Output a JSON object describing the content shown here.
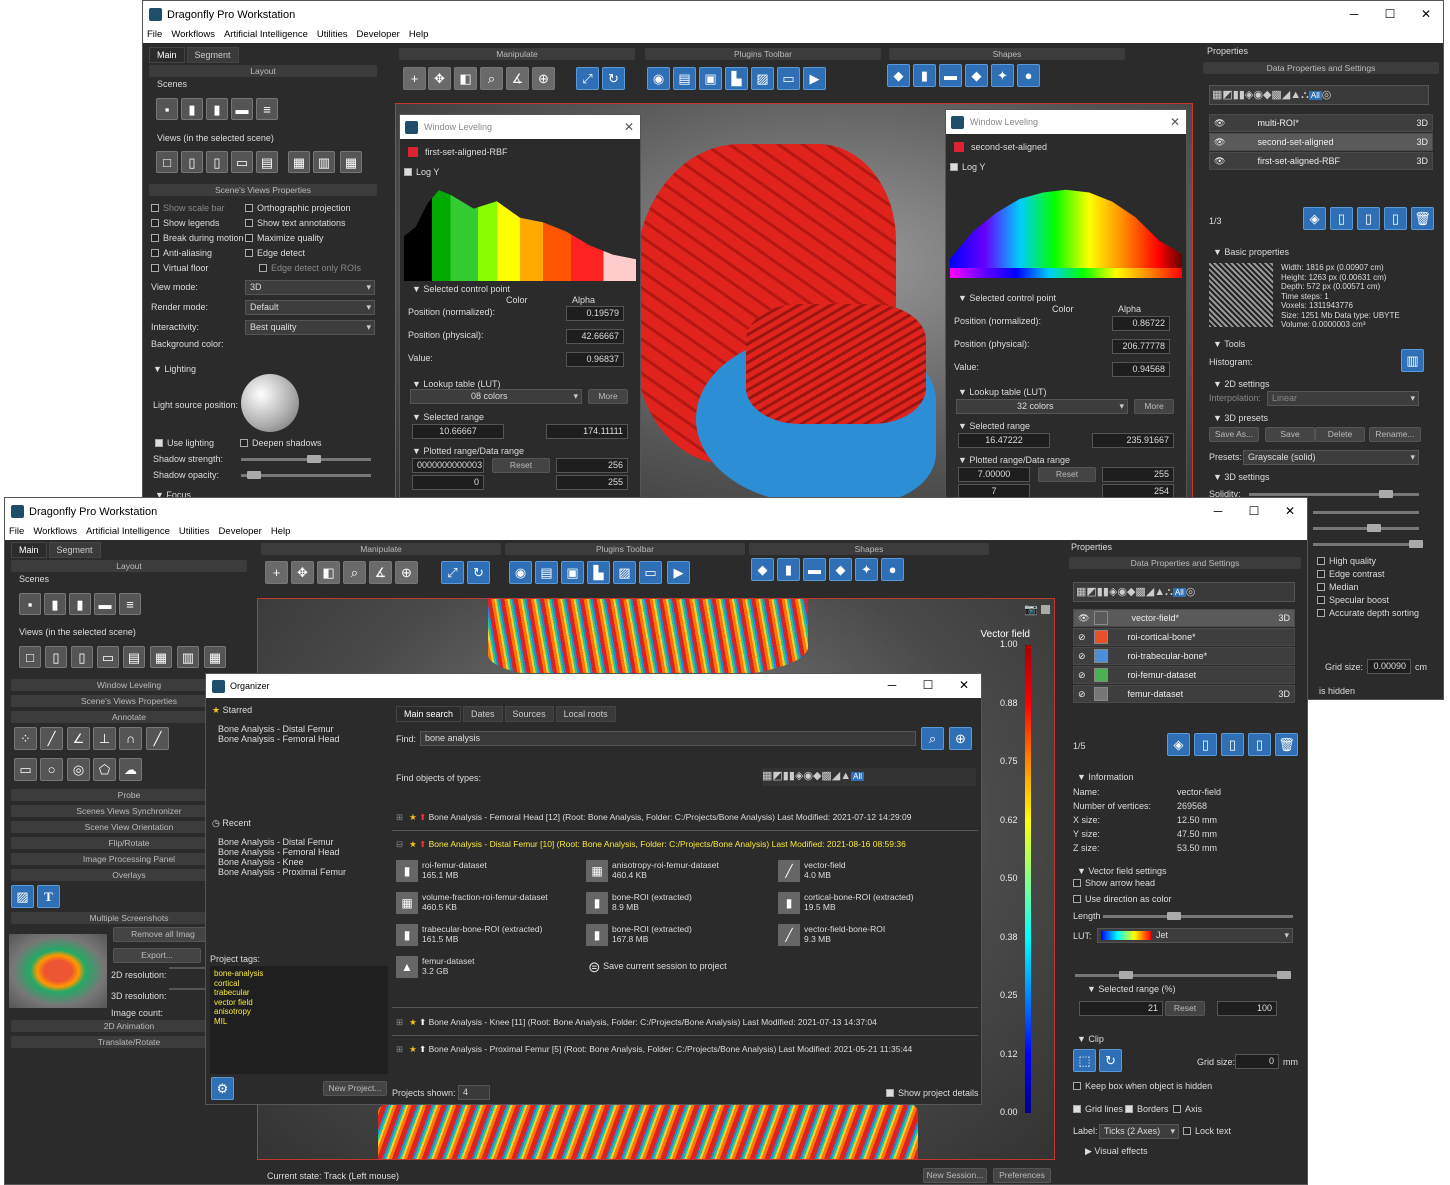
{
  "app": {
    "title": "Dragonfly Pro Workstation"
  },
  "menu": [
    "File",
    "Workflows",
    "Artificial Intelligence",
    "Utilities",
    "Developer",
    "Help"
  ],
  "tabs": {
    "main": "Main",
    "segment": "Segment"
  },
  "toolbars": {
    "manipulate": "Manipulate",
    "plugins": "Plugins Toolbar",
    "shapes": "Shapes"
  },
  "back": {
    "layout": "Layout",
    "scenes": "Scenes",
    "views": "Views (in the selected scene)",
    "svp": "Scene's Views Properties",
    "opts": [
      [
        "Show scale bar",
        "Orthographic projection"
      ],
      [
        "Show legends",
        "Show text annotations"
      ],
      [
        "Break during motion",
        "Maximize quality"
      ],
      [
        "Anti-aliasing",
        "Edge detect"
      ],
      [
        "Virtual floor",
        "Edge detect only ROIs"
      ]
    ],
    "view_mode_label": "View mode:",
    "view_mode": "3D",
    "render_mode_label": "Render mode:",
    "render_mode": "Default",
    "interactivity_label": "Interactivity:",
    "interactivity": "Best quality",
    "bg_label": "Background color:",
    "lighting": "Lighting",
    "light_source": "Light source position:",
    "use_lighting": "Use lighting",
    "deepen": "Deepen shadows",
    "shadow_strength": "Shadow strength:",
    "shadow_opacity": "Shadow opacity:",
    "focus": "Focus",
    "wl1": {
      "title": "Window Leveling",
      "dataset": "first-set-aligned-RBF",
      "logy": "Log Y",
      "selcp": "Selected control point",
      "pos_norm": "Position (normalized):",
      "pos_phys": "Position (physical):",
      "value": "Value:",
      "color": "Color",
      "alpha": "Alpha",
      "alpha_vals": [
        "0.19579",
        "42.66667",
        "0.96837"
      ],
      "lut": "Lookup table (LUT)",
      "lut_val": "08 colors",
      "more": "More",
      "selrange": "Selected range",
      "range": [
        "10.66667",
        "174.11111"
      ],
      "plotted": "Plotted range/Data range",
      "plot_a": "0000000000003",
      "reset": "Reset",
      "plot_b": "256",
      "plot_c": "0",
      "plot_d": "255"
    },
    "wl2": {
      "title": "Window Leveling",
      "dataset": "second-set-aligned",
      "logy": "Log Y",
      "selcp": "Selected control point",
      "pos_norm": "Position (normalized):",
      "pos_phys": "Position (physical):",
      "value": "Value:",
      "color": "Color",
      "alpha": "Alpha",
      "alpha_vals": [
        "0.86722",
        "206.77778",
        "0.94568"
      ],
      "lut": "Lookup table (LUT)",
      "lut_val": "32 colors",
      "more": "More",
      "selrange": "Selected range",
      "range": [
        "16.47222",
        "235.91667"
      ],
      "plotted": "Plotted range/Data range",
      "plot_a": "7.00000",
      "reset": "Reset",
      "plot_b": "255",
      "plot_c": "7",
      "plot_d": "254"
    },
    "props": "Properties",
    "dps": "Data Properties and Settings",
    "objects": [
      {
        "name": "multi-ROI*",
        "tag": "3D"
      },
      {
        "name": "second-set-aligned",
        "tag": "3D"
      },
      {
        "name": "first-set-aligned-RBF",
        "tag": "3D"
      }
    ],
    "count": "1/3",
    "basic": "Basic properties",
    "info": [
      "Width: 1816 px (0.00907 cm)",
      "Height: 1263 px (0.00631 cm)",
      "Depth: 572 px (0.00571 cm)",
      "Time steps: 1",
      "Voxels: 1311943776",
      "Size: 1251 Mb  Data type: UBYTE",
      "Volume: 0.0000003 cm³"
    ],
    "tools": "Tools",
    "histogram": "Histogram:",
    "s2d": "2D settings",
    "interp": "Interpolation:",
    "interp_val": "Linear",
    "presets3d": "3D presets",
    "saveas": "Save As...",
    "save": "Save",
    "delete": "Delete",
    "rename": "Rename...",
    "presets_label": "Presets:",
    "presets_val": "Grayscale (solid)",
    "s3d": "3D settings",
    "solidity": "Solidity:",
    "quality": [
      "High quality",
      "Edge contrast",
      "Median",
      "Specular boost",
      "Accurate depth sorting"
    ],
    "gridsize": "Grid size:",
    "gridsize_val": "0.00090",
    "gridsize_unit": "cm",
    "hidden": "is hidden"
  },
  "front": {
    "left": {
      "layout": "Layout",
      "scenes": "Scenes",
      "views": "Views (in the selected scene)",
      "wl": "Window Leveling",
      "svp": "Scene's Views Properties",
      "annotate": "Annotate",
      "probe": "Probe",
      "sync": "Scenes Views Synchronizer",
      "orient": "Scene View Orientation",
      "flip": "Flip/Rotate",
      "ipp": "Image Processing Panel",
      "overlays": "Overlays",
      "ms": "Multiple Screenshots",
      "remove": "Remove all Imag",
      "export": "Export...",
      "res2d": "2D resolution:",
      "res3d": "3D resolution:",
      "imgcount": "Image count:",
      "anim": "2D Animation",
      "tr": "Translate/Rotate"
    },
    "legend": {
      "title": "Vector field",
      "ticks": [
        "1.00",
        "0.88",
        "0.75",
        "0.62",
        "0.50",
        "0.38",
        "0.25",
        "0.12",
        "0.00"
      ]
    },
    "status": "Current state: Track (Left mouse)",
    "new_session": "New Session...",
    "preferences": "Preferences",
    "props": "Properties",
    "dps": "Data Properties and Settings",
    "objects": [
      {
        "name": "vector-field*",
        "tag": "3D",
        "color": "#555555"
      },
      {
        "name": "roi-cortical-bone*",
        "tag": "",
        "color": "#e8502a"
      },
      {
        "name": "roi-trabecular-bone*",
        "tag": "",
        "color": "#4a90d9"
      },
      {
        "name": "roi-femur-dataset",
        "tag": "",
        "color": "#4caf50"
      },
      {
        "name": "femur-dataset",
        "tag": "3D",
        "color": "#777777"
      }
    ],
    "count": "1/5",
    "information": "Information",
    "info": [
      [
        "Name:",
        "vector-field"
      ],
      [
        "Number of vertices:",
        "269568"
      ],
      [
        "X size:",
        "12.50 mm"
      ],
      [
        "Y size:",
        "47.50 mm"
      ],
      [
        "Z size:",
        "53.50 mm"
      ]
    ],
    "vfs": "Vector field settings",
    "show_arrow": "Show arrow head",
    "use_dir": "Use direction as color",
    "length": "Length",
    "lut": "LUT:",
    "lut_val": "Jet",
    "selrange": "Selected range (%)",
    "range_a": "21",
    "reset": "Reset",
    "range_b": "100",
    "clip": "Clip",
    "gridsize": "Grid size:",
    "gridsize_val": "0",
    "gridsize_unit": "mm",
    "keepbox": "Keep box when object is hidden",
    "gridlines": "Grid lines",
    "borders": "Borders",
    "axis": "Axis",
    "label": "Label:",
    "label_val": "Ticks (2 Axes)",
    "locktext": "Lock text",
    "visual": "Visual effects"
  },
  "organizer": {
    "title": "Organizer",
    "starred": "Starred",
    "starred_items": [
      "Bone Analysis - Distal Femur",
      "Bone Analysis - Femoral Head"
    ],
    "recent": "Recent",
    "recent_items": [
      "Bone Analysis - Distal Femur",
      "Bone Analysis - Femoral Head",
      "Bone Analysis - Knee",
      "Bone Analysis - Proximal Femur"
    ],
    "tags_label": "Project tags:",
    "tags": [
      "bone-analysis",
      "cortical",
      "trabecular",
      "vector field",
      "anisotropy",
      "MIL"
    ],
    "new_project": "New Project...",
    "tabs": [
      "Main search",
      "Dates",
      "Sources",
      "Local roots"
    ],
    "find_label": "Find:",
    "find_val": "bone analysis",
    "types_label": "Find objects of types:",
    "projects": [
      "Bone Analysis - Femoral Head [12] (Root: Bone Analysis, Folder: C:/Projects/Bone Analysis) Last Modified: 2021-07-12 14:29:09",
      "Bone Analysis - Distal Femur [10] (Root: Bone Analysis, Folder: C:/Projects/Bone Analysis) Last Modified: 2021-08-16 08:59:36",
      "Bone Analysis - Knee [11] (Root: Bone Analysis, Folder: C:/Projects/Bone Analysis) Last Modified: 2021-07-13 14:37:04",
      "Bone Analysis - Proximal Femur [5] (Root: Bone Analysis, Folder: C:/Projects/Bone Analysis) Last Modified: 2021-05-21 11:35:44"
    ],
    "items": [
      {
        "name": "roi-femur-dataset",
        "size": "165.1 MB"
      },
      {
        "name": "anisotropy-roi-femur-dataset",
        "size": "460.4 KB"
      },
      {
        "name": "vector-field",
        "size": "4.0 MB"
      },
      {
        "name": "volume-fraction-roi-femur-dataset",
        "size": "460.5 KB"
      },
      {
        "name": "bone-ROI (extracted)",
        "size": "8.9 MB"
      },
      {
        "name": "cortical-bone-ROI (extracted)",
        "size": "19.5 MB"
      },
      {
        "name": "trabecular-bone-ROI (extracted)",
        "size": "161.5 MB"
      },
      {
        "name": "bone-ROI (extracted)",
        "size": "167.8 MB"
      },
      {
        "name": "vector-field-bone-ROI",
        "size": "9.3 MB"
      },
      {
        "name": "femur-dataset",
        "size": "3.2 GB"
      }
    ],
    "save_session": "Save current session to project",
    "shown_label": "Projects shown:",
    "shown_val": "4",
    "show_details": "Show project details"
  }
}
